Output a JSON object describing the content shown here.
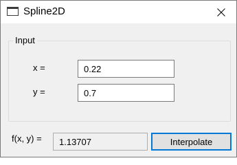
{
  "window": {
    "title": "Spline2D",
    "icon": "window-icon",
    "close_icon": "close-icon"
  },
  "input_group": {
    "legend": "Input",
    "x_label": "x =",
    "x_value": "0.22",
    "y_label": "y =",
    "y_value": "0.7"
  },
  "result": {
    "label": "f(x, y) =",
    "value": "1.13707"
  },
  "actions": {
    "interpolate_label": "Interpolate"
  },
  "colors": {
    "accent": "#0078d7",
    "window_bg": "#f0f0f0",
    "titlebar_bg": "#ffffff"
  }
}
